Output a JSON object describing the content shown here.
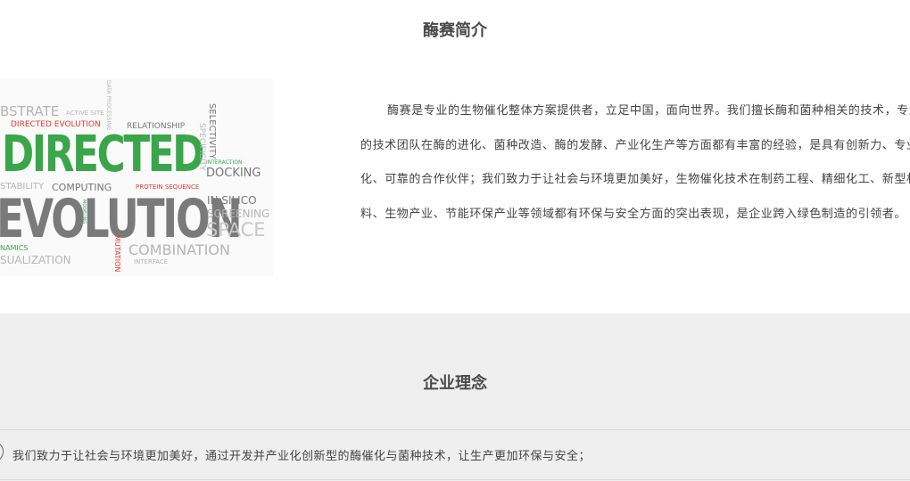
{
  "intro": {
    "title": "酶赛简介",
    "paragraph": "酶赛是专业的生物催化整体方案提供者，立足中国，面向世界。我们擅长酶和菌种相关的技术，专业的技术团队在酶的进化、菌种改造、酶的发酵、产业化生产等方面都有丰富的经验，是具有创新力、专业化、可靠的合作伙伴；我们致力于让社会与环境更加美好，生物催化技术在制药工程、精细化工、新型材料、生物产业、节能环保产业等领域都有环保与安全方面的突出表现，是企业跨入绿色制造的引领者。"
  },
  "wordcloud": {
    "words": {
      "data_processing": "DATA PROCESSING",
      "substrate": "BSTRATE",
      "active_site": "ACTIVE SITE",
      "relationship": "RELATIONSHIP",
      "selectivity": "SELECTIVITY",
      "directed_evolution_small": "DIRECTED EVOLUTION",
      "directed": "DIRECTED",
      "specificity": "SPECIFICITY",
      "interaction": "INTERACTION",
      "docking": "DOCKING",
      "stability": "STABILITY",
      "computing": "COMPUTING",
      "protein_sequence": "PROTEIN SEQUENCE",
      "evolution": "EVOLUTION",
      "modeling": "MODELING",
      "in_silico": "IN SILICO",
      "screening": "SCREENING",
      "space": "SPACE",
      "mutation": "MUTATION",
      "combination": "COMBINATION",
      "dynamics": "NAMICS",
      "visualization": "SUALIZATION",
      "interface": "INTERFACE"
    }
  },
  "philosophy": {
    "title": "企业理念",
    "items": [
      "我们致力于让社会与环境更加美好，通过开发并产业化创新型的酶催化与菌种技术，让生产更加环保与安全；"
    ]
  }
}
